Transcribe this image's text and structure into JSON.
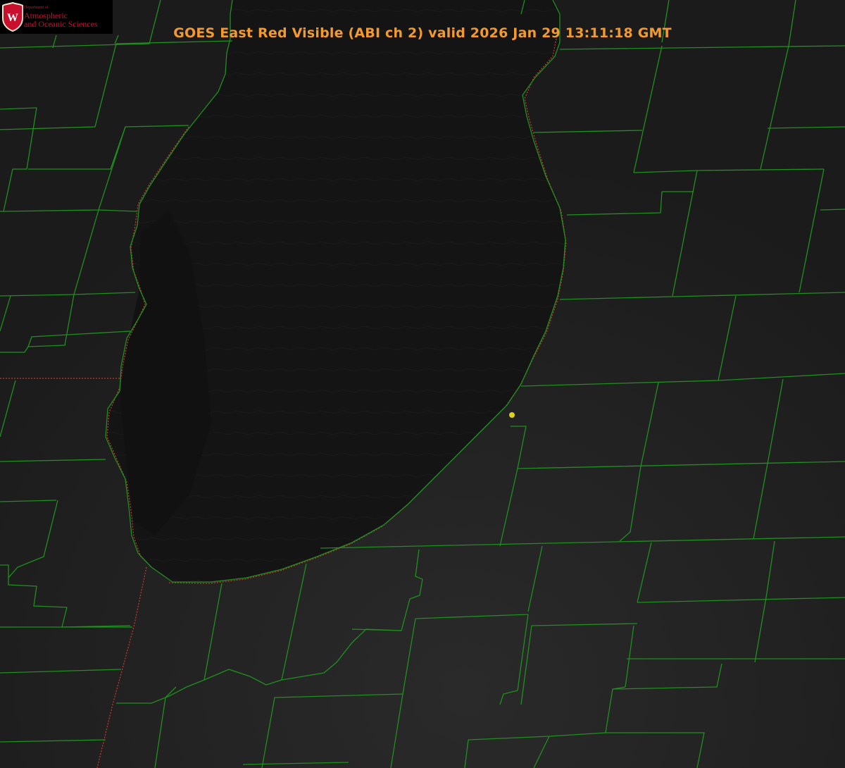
{
  "title": "GOES East Red Visible (ABI ch 2) valid 2026 Jan 29 13:11:18 GMT",
  "logo": {
    "department": "Department of",
    "line1": "Atmospheric",
    "line2": "and Oceanic Sciences",
    "shield_letter": "W"
  },
  "colors": {
    "background": "#1c1c1c",
    "lake": "#131313",
    "county_lines": "#1f8f1f",
    "state_lines": "#c0392b",
    "title": "#f29a2e",
    "brand": "#c8102e",
    "marker": "#e0d020"
  },
  "map": {
    "imagery": "GOES East Red Visible (ABI ch 2)",
    "features": [
      "lake-michigan",
      "county-boundaries",
      "state-boundaries",
      "site-marker"
    ]
  }
}
